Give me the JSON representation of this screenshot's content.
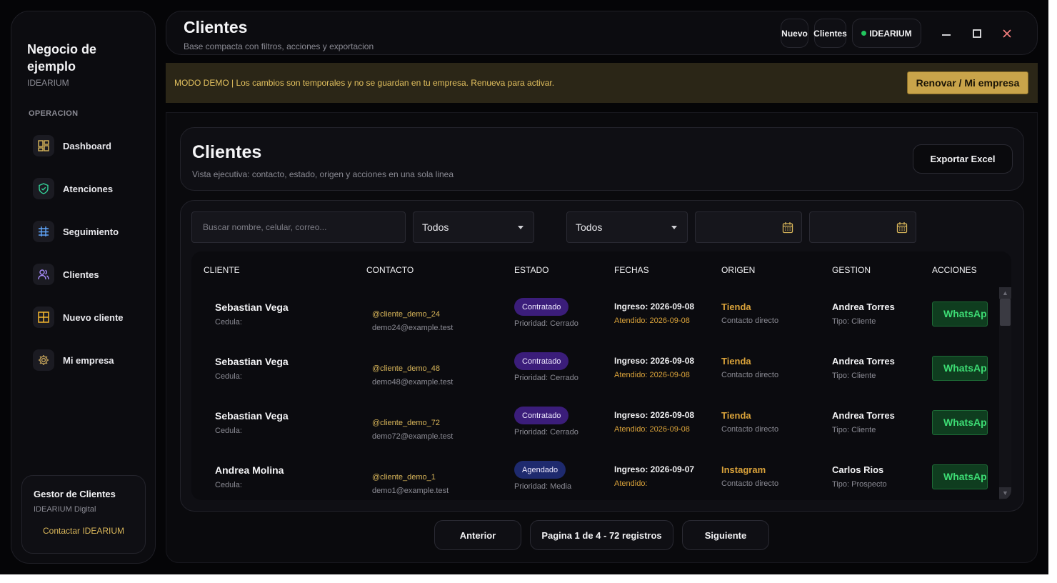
{
  "sidebar": {
    "brand_title": "Negocio de ejemplo",
    "brand_sub": "IDEARIUM",
    "section_label": "OPERACION",
    "items": [
      {
        "label": "Dashboard",
        "icon": "dashboard-icon"
      },
      {
        "label": "Atenciones",
        "icon": "shield-check-icon"
      },
      {
        "label": "Seguimiento",
        "icon": "grid-table-icon"
      },
      {
        "label": "Clientes",
        "icon": "users-icon"
      },
      {
        "label": "Nuevo cliente",
        "icon": "grid-plus-icon"
      },
      {
        "label": "Mi empresa",
        "icon": "gear-icon"
      }
    ],
    "card": {
      "title": "Gestor de Clientes",
      "sub": "IDEARIUM Digital",
      "link": "Contactar IDEARIUM"
    }
  },
  "topbar": {
    "title": "Clientes",
    "subtitle": "Base compacta con filtros, acciones y exportacion",
    "pill_nuevo": "Nuevo",
    "pill_clientes": "Clientes",
    "pill_org": "IDEARIUM",
    "minimize": "—",
    "maximize": "☐",
    "close": "✕"
  },
  "banner": {
    "text": "MODO DEMO | Los cambios son temporales y no se guardan en tu empresa. Renueva para activar.",
    "button": "Renovar / Mi empresa"
  },
  "header": {
    "title": "Clientes",
    "subtitle": "Vista ejecutiva: contacto, estado, origen y acciones en una sola linea",
    "export": "Exportar Excel"
  },
  "filters": {
    "search_placeholder": "Buscar nombre, celular, correo...",
    "select1": "Todos",
    "select2": "Todos"
  },
  "table": {
    "columns": [
      "CLIENTE",
      "CONTACTO",
      "ESTADO",
      "FECHAS",
      "ORIGEN",
      "GESTION",
      "ACCIONES"
    ],
    "rows": [
      {
        "name": "Sebastian Vega",
        "cedula": "Cedula:",
        "user": "@cliente_demo_24",
        "email": "demo24@example.test",
        "estado": "Contratado",
        "estado_color": "#3b1d7a",
        "prioridad": "Prioridad: Cerrado",
        "ingreso": "Ingreso: 2026-09-08",
        "atendido": "Atendido: 2026-09-08",
        "origen": "Tienda",
        "origen_sub": "Contacto directo",
        "gestor": "Andrea Torres",
        "tipo": "Tipo: Cliente",
        "action": "WhatsApp"
      },
      {
        "name": "Sebastian Vega",
        "cedula": "Cedula:",
        "user": "@cliente_demo_48",
        "email": "demo48@example.test",
        "estado": "Contratado",
        "estado_color": "#3b1d7a",
        "prioridad": "Prioridad: Cerrado",
        "ingreso": "Ingreso: 2026-09-08",
        "atendido": "Atendido: 2026-09-08",
        "origen": "Tienda",
        "origen_sub": "Contacto directo",
        "gestor": "Andrea Torres",
        "tipo": "Tipo: Cliente",
        "action": "WhatsApp"
      },
      {
        "name": "Sebastian Vega",
        "cedula": "Cedula:",
        "user": "@cliente_demo_72",
        "email": "demo72@example.test",
        "estado": "Contratado",
        "estado_color": "#3b1d7a",
        "prioridad": "Prioridad: Cerrado",
        "ingreso": "Ingreso: 2026-09-08",
        "atendido": "Atendido: 2026-09-08",
        "origen": "Tienda",
        "origen_sub": "Contacto directo",
        "gestor": "Andrea Torres",
        "tipo": "Tipo: Cliente",
        "action": "WhatsApp"
      },
      {
        "name": "Andrea Molina",
        "cedula": "Cedula:",
        "user": "@cliente_demo_1",
        "email": "demo1@example.test",
        "estado": "Agendado",
        "estado_color": "#1e2a6e",
        "prioridad": "Prioridad: Media",
        "ingreso": "Ingreso: 2026-09-07",
        "atendido": "Atendido:",
        "origen": "Instagram",
        "origen_sub": "Contacto directo",
        "gestor": "Carlos Rios",
        "tipo": "Tipo: Prospecto",
        "action": "WhatsApp"
      }
    ]
  },
  "pagination": {
    "prev": "Anterior",
    "info": "Pagina 1 de 4 - 72 registros",
    "next": "Siguiente"
  },
  "colors": {
    "accent_gold": "#d9b65a",
    "whatsapp_green": "#3ddc74",
    "status_dot": "#22c55e"
  }
}
